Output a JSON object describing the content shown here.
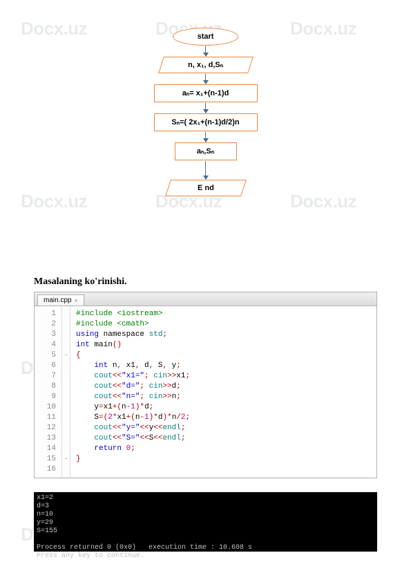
{
  "watermark": "Docx.uz",
  "flowchart": {
    "start": "start",
    "input": "n, x₁, d,Sₙ",
    "proc1": "aₙ= x₁+(n-1)d",
    "proc2": "Sₙ=( 2x₁+(n-1)d/2)n",
    "output": "aₙ,Sₙ",
    "end": "E nd"
  },
  "section_title": "Masalaning ko'rinishi.",
  "tab_name": "main.cpp",
  "code": {
    "lines": [
      {
        "n": 1,
        "indent": 0,
        "tokens": [
          [
            "pre",
            "#include <iostream>"
          ]
        ]
      },
      {
        "n": 2,
        "indent": 0,
        "tokens": [
          [
            "pre",
            "#include <cmath>"
          ]
        ]
      },
      {
        "n": 3,
        "indent": 0,
        "tokens": [
          [
            "kw",
            "using"
          ],
          [
            "ident",
            " namespace "
          ],
          [
            "kw2",
            "std"
          ],
          [
            "op",
            ";"
          ]
        ]
      },
      {
        "n": 4,
        "indent": 0,
        "tokens": [
          [
            "kw",
            "int"
          ],
          [
            "ident",
            " main"
          ],
          [
            "op",
            "()"
          ]
        ]
      },
      {
        "n": 5,
        "indent": 0,
        "fold": "-",
        "tokens": [
          [
            "op",
            "{"
          ]
        ]
      },
      {
        "n": 6,
        "indent": 1,
        "tokens": [
          [
            "kw",
            "int"
          ],
          [
            "ident",
            " n"
          ],
          [
            "op",
            ","
          ],
          [
            "ident",
            " x1"
          ],
          [
            "op",
            ","
          ],
          [
            "ident",
            " d"
          ],
          [
            "op",
            ","
          ],
          [
            "ident",
            " S"
          ],
          [
            "op",
            ","
          ],
          [
            "ident",
            " y"
          ],
          [
            "op",
            ";"
          ]
        ]
      },
      {
        "n": 7,
        "indent": 1,
        "tokens": [
          [
            "kw2",
            "cout"
          ],
          [
            "op",
            "<<"
          ],
          [
            "str",
            "\"x1=\""
          ],
          [
            "op",
            "; "
          ],
          [
            "kw2",
            "cin"
          ],
          [
            "op",
            ">>"
          ],
          [
            "ident",
            "x1"
          ],
          [
            "op",
            ";"
          ]
        ]
      },
      {
        "n": 8,
        "indent": 1,
        "tokens": [
          [
            "kw2",
            "cout"
          ],
          [
            "op",
            "<<"
          ],
          [
            "str",
            "\"d=\""
          ],
          [
            "op",
            "; "
          ],
          [
            "kw2",
            "cin"
          ],
          [
            "op",
            ">>"
          ],
          [
            "ident",
            "d"
          ],
          [
            "op",
            ";"
          ]
        ]
      },
      {
        "n": 9,
        "indent": 1,
        "tokens": [
          [
            "kw2",
            "cout"
          ],
          [
            "op",
            "<<"
          ],
          [
            "str",
            "\"n=\""
          ],
          [
            "op",
            "; "
          ],
          [
            "kw2",
            "cin"
          ],
          [
            "op",
            ">>"
          ],
          [
            "ident",
            "n"
          ],
          [
            "op",
            ";"
          ]
        ]
      },
      {
        "n": 10,
        "indent": 1,
        "tokens": [
          [
            "ident",
            "y"
          ],
          [
            "op",
            "="
          ],
          [
            "ident",
            "x1"
          ],
          [
            "op",
            "+("
          ],
          [
            "ident",
            "n"
          ],
          [
            "op",
            "-"
          ],
          [
            "num",
            "1"
          ],
          [
            "op",
            ")*"
          ],
          [
            "ident",
            "d"
          ],
          [
            "op",
            ";"
          ]
        ]
      },
      {
        "n": 11,
        "indent": 1,
        "tokens": [
          [
            "ident",
            "S"
          ],
          [
            "op",
            "=("
          ],
          [
            "num",
            "2"
          ],
          [
            "op",
            "*"
          ],
          [
            "ident",
            "x1"
          ],
          [
            "op",
            "+("
          ],
          [
            "ident",
            "n"
          ],
          [
            "op",
            "-"
          ],
          [
            "num",
            "1"
          ],
          [
            "op",
            ")*"
          ],
          [
            "ident",
            "d"
          ],
          [
            "op",
            ")*"
          ],
          [
            "ident",
            "n"
          ],
          [
            "op",
            "/"
          ],
          [
            "num",
            "2"
          ],
          [
            "op",
            ";"
          ]
        ]
      },
      {
        "n": 12,
        "indent": 1,
        "tokens": [
          [
            "kw2",
            "cout"
          ],
          [
            "op",
            "<<"
          ],
          [
            "str",
            "\"y=\""
          ],
          [
            "op",
            "<<"
          ],
          [
            "ident",
            "y"
          ],
          [
            "op",
            "<<"
          ],
          [
            "kw2",
            "endl"
          ],
          [
            "op",
            ";"
          ]
        ]
      },
      {
        "n": 13,
        "indent": 1,
        "tokens": [
          [
            "kw2",
            "cout"
          ],
          [
            "op",
            "<<"
          ],
          [
            "str",
            "\"S=\""
          ],
          [
            "op",
            "<<"
          ],
          [
            "ident",
            "S"
          ],
          [
            "op",
            "<<"
          ],
          [
            "kw2",
            "endl"
          ],
          [
            "op",
            ";"
          ]
        ]
      },
      {
        "n": 14,
        "indent": 1,
        "tokens": [
          [
            "kw",
            "return"
          ],
          [
            "ident",
            " "
          ],
          [
            "num",
            "0"
          ],
          [
            "op",
            ";"
          ]
        ]
      },
      {
        "n": 15,
        "indent": 0,
        "fold": "-",
        "tokens": [
          [
            "op",
            "}"
          ]
        ]
      },
      {
        "n": 16,
        "indent": 0,
        "tokens": []
      }
    ]
  },
  "console_output": "x1=2\nd=3\nn=10\ny=29\nS=155\n\nProcess returned 0 (0x0)   execution time : 10.608 s\nPress any key to continue."
}
